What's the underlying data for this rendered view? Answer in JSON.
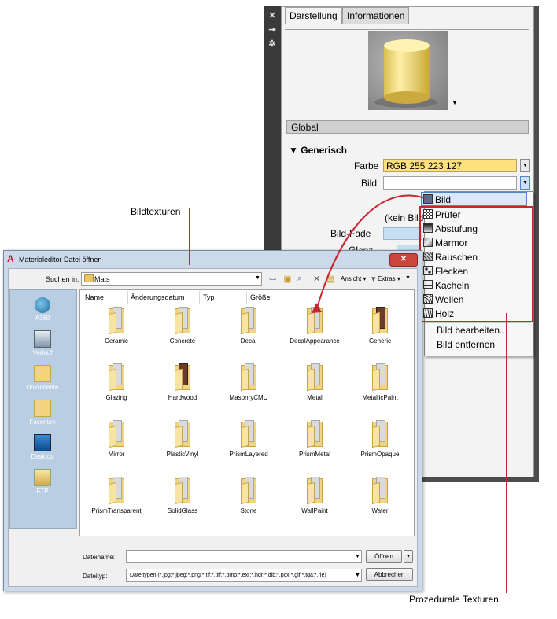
{
  "callouts": {
    "bildtexturen": "Bildtexturen",
    "prozedural": "Prozedurale Texturen"
  },
  "panel": {
    "tabs": [
      "Darstellung",
      "Informationen"
    ],
    "section_global": "Global",
    "section_generisch": "Generisch",
    "farbe_label": "Farbe",
    "farbe_value": "RGB 255 223 127",
    "farbe_color": "#ffdf7f",
    "bild_label": "Bild",
    "kein_bild": "(kein Bild",
    "bild_fade_label": "Bild-Fade",
    "glanz_label": "Glanz"
  },
  "menu": {
    "items": [
      "Bild",
      "Prüfer",
      "Abstufung",
      "Marmor",
      "Rauschen",
      "Flecken",
      "Kacheln",
      "Wellen",
      "Holz"
    ],
    "actions": [
      "Bild bearbeiten..",
      "Bild entfernen"
    ]
  },
  "dialog": {
    "title": "Materialeditor Datei öffnen",
    "suchen_label": "Suchen in:",
    "folder": "Mats",
    "ansicht": "Ansicht",
    "extras": "Extras",
    "places": [
      "A360",
      "Verlauf",
      "Dokumente",
      "Favoriten",
      "Desktop",
      "FTP"
    ],
    "columns": [
      "Name",
      "Änderungsdatum",
      "Typ",
      "Größe"
    ],
    "folders": [
      "Ceramic",
      "Concrete",
      "Decal",
      "DecalAppearance",
      "Generic",
      "Glazing",
      "Hardwood",
      "MasonryCMU",
      "Metal",
      "MetallicPaint",
      "Mirror",
      "PlasticVinyl",
      "PrismLayered",
      "PrismMetal",
      "PrismOpaque",
      "PrismTransparent",
      "SolidGlass",
      "Stone",
      "WallPaint",
      "Water"
    ],
    "dateiname_label": "Dateiname:",
    "dateityp_label": "Dateityp:",
    "dateityp_value": "Dateitypen  (*.jpg;*.jpeg;*.png;*.tif;*.tiff;*.bmp;*.exr;*.hdr;*.dib;*.pcx;*.gif;*.tga;*.rle)",
    "open_button": "Öffnen",
    "cancel_button": "Abbrechen"
  }
}
